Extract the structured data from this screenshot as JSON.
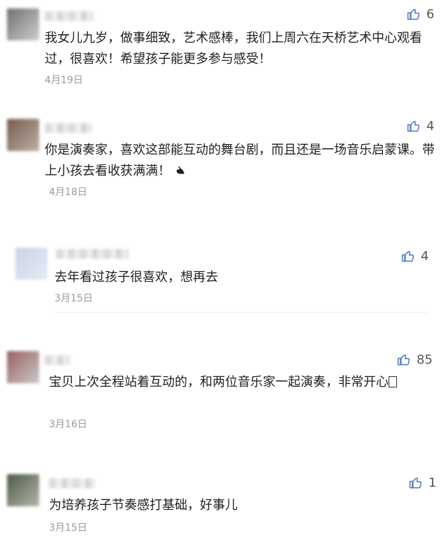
{
  "comments": [
    {
      "likes": "6",
      "text": "我女儿九岁，做事细致，艺术感棒，我们上周六在天桥艺术中心观看过，很喜欢！希望孩子能更多参与感受！",
      "date": "4月19日",
      "avatar_colors": [
        "#6f6f6f",
        "#cfcfcf"
      ]
    },
    {
      "likes": "4",
      "text": "你是演奏家，喜欢这部能互动的舞台剧，而且还是一场音乐启蒙课。带上小孩去看收获满满！",
      "emoji": "pointing-hand-icon",
      "date": "4月18日",
      "avatar_colors": [
        "#7a5a4a",
        "#b8b0a8"
      ]
    },
    {
      "likes": "4",
      "text": "去年看过孩子很喜欢，想再去",
      "date": "3月15日",
      "avatar_colors": [
        "#c9d3e8",
        "#e6ebf3"
      ]
    },
    {
      "likes": "85",
      "text": "宝贝上次全程站着互动的，和两位音乐家一起演奏，非常开心",
      "trailing_glyph": "missing-glyph-box",
      "date": "3月16日",
      "avatar_colors": [
        "#9a6060",
        "#c8c8c8"
      ]
    },
    {
      "likes": "1",
      "text": "为培养孩子节奏感打基础，好事儿",
      "date": "3月15日",
      "avatar_colors": [
        "#4e5a48",
        "#b2b6a8"
      ]
    }
  ],
  "colors": {
    "like_icon": "#4a78c7",
    "date": "#9a9a9a",
    "text": "#1f1f1f"
  }
}
